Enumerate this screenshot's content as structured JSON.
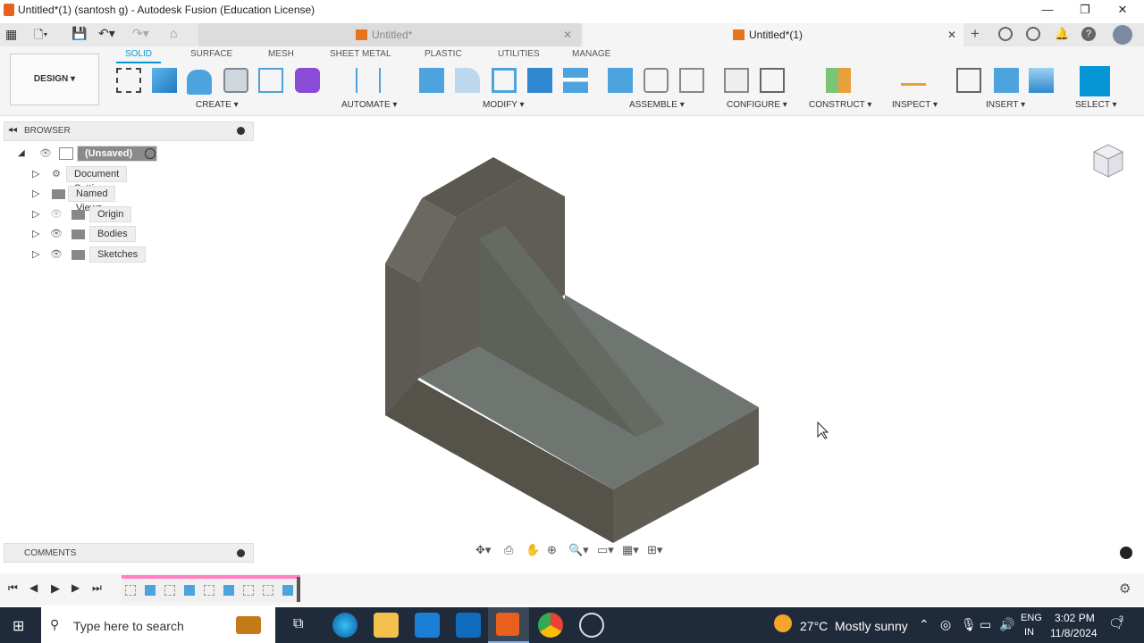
{
  "window": {
    "title": "Untitled*(1) (santosh g) - Autodesk Fusion (Education License)"
  },
  "tabs": [
    {
      "label": "Untitled*"
    },
    {
      "label": "Untitled*(1)"
    }
  ],
  "toolbar": {
    "workspace": "DESIGN",
    "tabs": [
      "SOLID",
      "SURFACE",
      "MESH",
      "SHEET METAL",
      "PLASTIC",
      "UTILITIES",
      "MANAGE"
    ],
    "groups": [
      "CREATE",
      "AUTOMATE",
      "MODIFY",
      "ASSEMBLE",
      "CONFIGURE",
      "CONSTRUCT",
      "INSPECT",
      "INSERT",
      "SELECT"
    ]
  },
  "browser": {
    "title": "BROWSER",
    "root": "(Unsaved)",
    "items": [
      "Document Settings",
      "Named Views",
      "Origin",
      "Bodies",
      "Sketches"
    ]
  },
  "comments": {
    "title": "COMMENTS"
  },
  "taskbar": {
    "search_placeholder": "Type here to search",
    "weather": "27°C  Mostly sunny",
    "lang1": "ENG",
    "lang2": "IN",
    "time": "3:02 PM",
    "date": "11/8/2024",
    "notif_count": "3"
  }
}
